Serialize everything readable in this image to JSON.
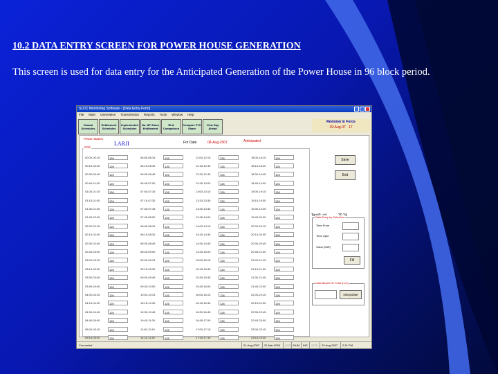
{
  "slide": {
    "heading": "10.2 DATA ENTRY SCREEN FOR POWER HOUSE GENERATION",
    "description": "This screen is used for data entry for the Anticipated Generation of the Power House in 96 block period."
  },
  "window": {
    "title": "SLDC Monitoring Software - [Data Entry Form]",
    "menu": [
      "File",
      "Main",
      "Generation",
      "Transmission",
      "Reports",
      "Tools",
      "Window",
      "Help"
    ]
  },
  "toolbar": {
    "buttons": [
      "Drawal Schedules",
      "Entitlement Schedules",
      "Implemented Schedules",
      "No. NP Share Entitlement",
      "RLA Comparison",
      "Compare PTC Share",
      "View Day Ahead"
    ],
    "revision_label": "Revision in Force",
    "revision_date": "29-Aug-07",
    "revision_no": "17"
  },
  "form": {
    "power_station_label": "Power Station",
    "station_name": "LARJI",
    "for_date_label": "For Date",
    "for_date_value": "08-Aug-2007",
    "anticipated_label": "Anticipated",
    "grid_label": "Grid",
    "columns": [
      {
        "times": [
          "00:00-00:15",
          "00:15-00:30",
          "00:30-00:45",
          "00:45-01:00",
          "01:00-01:15",
          "01:15-01:30",
          "01:30-01:45",
          "01:45-02:00",
          "02:00-02:15",
          "02:15-02:30",
          "02:30-02:45",
          "02:45-03:00",
          "03:00-03:15",
          "03:15-03:30",
          "03:30-03:45",
          "03:45-04:00",
          "04:00-04:15",
          "04:15-04:30",
          "04:30-04:45",
          "04:45-05:00",
          "05:00-05:15",
          "05:15-05:30",
          "05:30-05:45",
          "05:45-06:00"
        ],
        "values": [
          "126",
          "126",
          "126",
          "126",
          "126",
          "126",
          "126",
          "126",
          "126",
          "126",
          "126",
          "126",
          "126",
          "126",
          "126",
          "126",
          "126",
          "126",
          "126",
          "126",
          "126",
          "126",
          "126",
          "126"
        ]
      },
      {
        "times": [
          "06:00-06:15",
          "06:15-06:30",
          "06:30-06:45",
          "06:45-07:00",
          "07:00-07:15",
          "07:15-07:30",
          "07:30-07:45",
          "07:45-08:00",
          "08:00-08:15",
          "08:15-08:30",
          "08:30-08:45",
          "08:45-09:00",
          "09:00-09:15",
          "09:15-09:30",
          "09:30-09:45",
          "09:45-10:00",
          "10:00-10:15",
          "10:15-10:30",
          "10:30-10:45",
          "10:45-11:00",
          "11:00-11:15",
          "11:15-11:30",
          "11:30-11:45",
          "11:45-12:00"
        ],
        "values": [
          "126",
          "126",
          "126",
          "126",
          "126",
          "126",
          "126",
          "126",
          "126",
          "126",
          "126",
          "126",
          "126",
          "126",
          "126",
          "126",
          "126",
          "126",
          "126",
          "126",
          "126",
          "126",
          "126",
          "126"
        ]
      },
      {
        "times": [
          "12:00-12:15",
          "12:15-12:30",
          "12:30-12:45",
          "12:45-13:00",
          "13:00-13:15",
          "13:15-13:30",
          "13:30-13:45",
          "13:45-14:00",
          "14:00-14:15",
          "14:15-14:30",
          "14:30-14:45",
          "14:45-15:00",
          "15:00-15:15",
          "15:15-15:30",
          "15:30-15:45",
          "15:45-16:00",
          "16:00-16:15",
          "16:15-16:30",
          "16:30-16:45",
          "16:45-17:00",
          "17:00-17:15",
          "17:15-17:30",
          "17:30-17:45",
          "17:45-18:00"
        ],
        "values": [
          "126",
          "126",
          "126",
          "126",
          "126",
          "126",
          "126",
          "126",
          "126",
          "126",
          "126",
          "126",
          "126",
          "126",
          "126",
          "126",
          "126",
          "126",
          "126",
          "126",
          "126",
          "126",
          "126",
          "126"
        ]
      },
      {
        "times": [
          "18:00-18:15",
          "18:15-18:30",
          "18:30-18:45",
          "18:45-19:00",
          "19:00-19:15",
          "19:15-19:30",
          "19:30-19:45",
          "19:45-20:00",
          "20:00-20:15",
          "20:15-20:30",
          "20:30-20:45",
          "20:45-21:00",
          "21:00-21:15",
          "21:15-21:30",
          "21:30-21:45",
          "21:45-22:00",
          "22:00-22:15",
          "22:15-22:30",
          "22:30-22:45",
          "22:45-23:00",
          "23:00-23:15",
          "23:15-23:30",
          "23:30-23:45",
          "23:45-24:00"
        ],
        "values": [
          "126",
          "126",
          "126",
          "126",
          "126",
          "126",
          "126",
          "126",
          "126",
          "126",
          "126",
          "126",
          "126",
          "126",
          "126",
          "126",
          "126",
          "126",
          "126",
          "126",
          "126",
          "126",
          "126",
          "126"
        ]
      }
    ],
    "save_label": "Save",
    "exit_label": "Exit",
    "total_label": "Total(Lu's)",
    "total_value": "30.24",
    "data_entry_title": "Data Entry by Selection",
    "time_from_label": "Time From",
    "time_upto_label": "Time Upto",
    "value_label": "Value (MW)",
    "fill_label": "Fill",
    "interp_title": "Data Based On Total (Lu's)",
    "interpolate_label": "Interpolate"
  },
  "statusbar": {
    "status": "Connected",
    "date1": "01-Aug-2007",
    "date2": "31-Mar-2009",
    "caps": "CAPS",
    "num": "NUM",
    "ins": "INS",
    "scrl": "SCRL",
    "date3": "29-Aug-2007",
    "time": "2:31 PM"
  }
}
